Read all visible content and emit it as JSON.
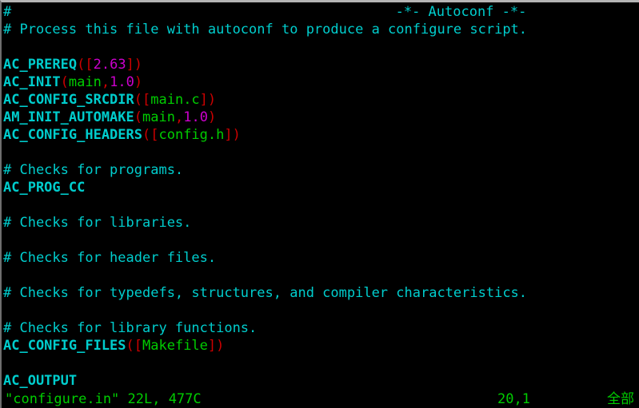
{
  "window": {
    "app": "vim",
    "filename": "configure.in"
  },
  "colors": {
    "background": "#000000",
    "comment": "#00cdcd",
    "macro": "#00cdcd",
    "delimiter": "#cd0000",
    "string": "#00cd00",
    "number": "#cd00cd",
    "status": "#00cd00",
    "frame": "#b4b4b4"
  },
  "buffer": {
    "lines": [
      {
        "n": 1,
        "segments": [
          {
            "text": "#",
            "type": "comment"
          }
        ]
      },
      {
        "n": 2,
        "segments": [
          {
            "text": "# Process this file with autoconf to produce a configure script.",
            "type": "comment"
          }
        ]
      },
      {
        "n": 3,
        "segments": []
      },
      {
        "n": 4,
        "segments": [
          {
            "text": "AC_PREREQ",
            "type": "macro"
          },
          {
            "text": "([",
            "type": "delim"
          },
          {
            "text": "2.63",
            "type": "number"
          },
          {
            "text": "])",
            "type": "delim"
          }
        ]
      },
      {
        "n": 5,
        "segments": [
          {
            "text": "AC_INIT",
            "type": "macro"
          },
          {
            "text": "(",
            "type": "delim"
          },
          {
            "text": "main",
            "type": "string"
          },
          {
            "text": ",",
            "type": "delim"
          },
          {
            "text": "1.0",
            "type": "number"
          },
          {
            "text": ")",
            "type": "delim"
          }
        ]
      },
      {
        "n": 6,
        "segments": [
          {
            "text": "AC_CONFIG_SRCDIR",
            "type": "macro"
          },
          {
            "text": "([",
            "type": "delim"
          },
          {
            "text": "main.c",
            "type": "string"
          },
          {
            "text": "])",
            "type": "delim"
          }
        ]
      },
      {
        "n": 7,
        "segments": [
          {
            "text": "AM_INIT_AUTOMAKE",
            "type": "macro"
          },
          {
            "text": "(",
            "type": "delim"
          },
          {
            "text": "main",
            "type": "string"
          },
          {
            "text": ",",
            "type": "delim"
          },
          {
            "text": "1.0",
            "type": "number"
          },
          {
            "text": ")",
            "type": "delim"
          }
        ]
      },
      {
        "n": 8,
        "segments": [
          {
            "text": "AC_CONFIG_HEADERS",
            "type": "macro"
          },
          {
            "text": "([",
            "type": "delim"
          },
          {
            "text": "config.h",
            "type": "string"
          },
          {
            "text": "])",
            "type": "delim"
          }
        ]
      },
      {
        "n": 9,
        "segments": []
      },
      {
        "n": 10,
        "segments": [
          {
            "text": "# Checks for programs.",
            "type": "comment"
          }
        ]
      },
      {
        "n": 11,
        "segments": [
          {
            "text": "AC_PROG_CC",
            "type": "macro"
          }
        ]
      },
      {
        "n": 12,
        "segments": []
      },
      {
        "n": 13,
        "segments": [
          {
            "text": "# Checks for libraries.",
            "type": "comment"
          }
        ]
      },
      {
        "n": 14,
        "segments": []
      },
      {
        "n": 15,
        "segments": [
          {
            "text": "# Checks for header files.",
            "type": "comment"
          }
        ]
      },
      {
        "n": 16,
        "segments": []
      },
      {
        "n": 17,
        "segments": [
          {
            "text": "# Checks for typedefs, structures, and compiler characteristics.",
            "type": "comment"
          }
        ]
      },
      {
        "n": 18,
        "segments": []
      },
      {
        "n": 19,
        "segments": [
          {
            "text": "# Checks for library functions.",
            "type": "comment"
          }
        ]
      },
      {
        "n": 20,
        "segments": [
          {
            "text": "AC_CONFIG_FILES",
            "type": "macro"
          },
          {
            "text": "([",
            "type": "delim"
          },
          {
            "text": "Makefile",
            "type": "string"
          },
          {
            "text": "])",
            "type": "delim"
          }
        ]
      },
      {
        "n": 21,
        "segments": []
      },
      {
        "n": 22,
        "segments": [
          {
            "text": "AC_OUTPUT",
            "type": "macro"
          }
        ]
      }
    ],
    "modeline_header": "-*- Autoconf -*-",
    "modeline_header_column": 51
  },
  "statusline": {
    "file_info": "\"configure.in\" 22L, 477C",
    "cursor_position": "20,1",
    "scroll_indicator": "全部"
  }
}
